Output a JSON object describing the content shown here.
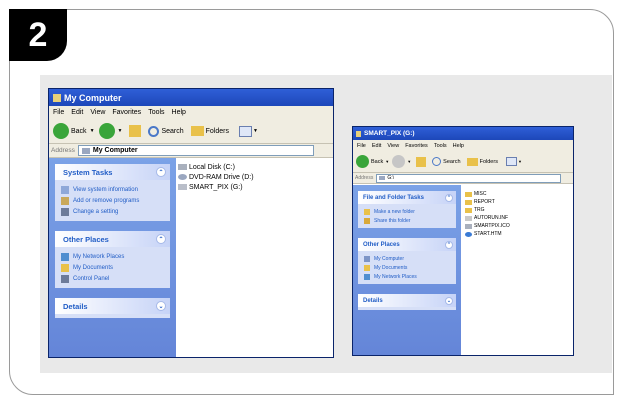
{
  "step_number": "2",
  "window_left": {
    "title": "My Computer",
    "menu": [
      "File",
      "Edit",
      "View",
      "Favorites",
      "Tools",
      "Help"
    ],
    "toolbar": {
      "back": "Back",
      "search": "Search",
      "folders": "Folders"
    },
    "address_label": "Address",
    "address_value": "My Computer",
    "groups": [
      {
        "title": "System Tasks",
        "items": [
          {
            "label": "View system information",
            "icon": "info-icon"
          },
          {
            "label": "Add or remove programs",
            "icon": "programs-icon"
          },
          {
            "label": "Change a setting",
            "icon": "control-panel-icon"
          }
        ]
      },
      {
        "title": "Other Places",
        "items": [
          {
            "label": "My Network Places",
            "icon": "network-icon"
          },
          {
            "label": "My Documents",
            "icon": "folder-icon"
          },
          {
            "label": "Control Panel",
            "icon": "control-panel-icon"
          }
        ]
      },
      {
        "title": "Details",
        "items": []
      }
    ],
    "files": [
      {
        "name": "Local Disk (C:)",
        "icon": "hard-disk-icon"
      },
      {
        "name": "DVD-RAM Drive (D:)",
        "icon": "dvd-drive-icon"
      },
      {
        "name": "SMART_PIX (G:)",
        "icon": "removable-drive-icon"
      }
    ]
  },
  "window_right": {
    "title": "SMART_PIX (G:)",
    "menu": [
      "File",
      "Edit",
      "View",
      "Favorites",
      "Tools",
      "Help"
    ],
    "toolbar": {
      "back": "Back",
      "search": "Search",
      "folders": "Folders"
    },
    "address_label": "Address",
    "address_value": "G:\\",
    "groups": [
      {
        "title": "File and Folder Tasks",
        "items": [
          {
            "label": "Make a new folder",
            "icon": "new-folder-icon"
          },
          {
            "label": "Share this folder",
            "icon": "share-folder-icon"
          }
        ]
      },
      {
        "title": "Other Places",
        "items": [
          {
            "label": "My Computer",
            "icon": "computer-icon"
          },
          {
            "label": "My Documents",
            "icon": "folder-icon"
          },
          {
            "label": "My Network Places",
            "icon": "network-icon"
          }
        ]
      },
      {
        "title": "Details",
        "items": []
      }
    ],
    "files": [
      {
        "name": "MISC",
        "icon": "folder-icon"
      },
      {
        "name": "REPORT",
        "icon": "folder-icon"
      },
      {
        "name": "TRG",
        "icon": "folder-icon"
      },
      {
        "name": "AUTORUN.INF",
        "icon": "settings-file-icon"
      },
      {
        "name": "SMARTPIX.ICO",
        "icon": "ico-file-icon"
      },
      {
        "name": "START.HTM",
        "icon": "html-file-icon"
      }
    ]
  },
  "colors": {
    "titlebar": "#2f5fd7",
    "taskpane": "#7ba2e7",
    "link": "#215dc6",
    "badge": "#000000"
  }
}
